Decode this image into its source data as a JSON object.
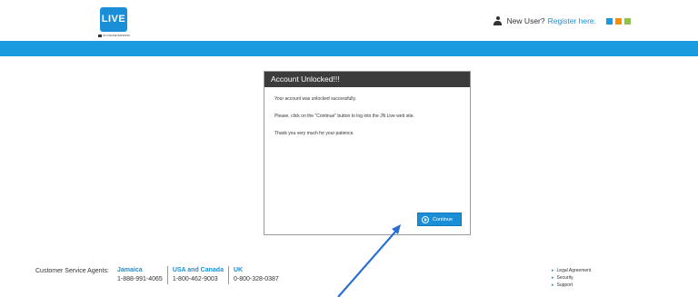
{
  "header": {
    "logo_text": "LIVE",
    "logo_subtext": "JN ONLINE BANKING",
    "new_user_text": "New User?",
    "register_link": "Register here.",
    "color_squares": [
      "#1a9be0",
      "#f39200",
      "#8cc63f"
    ]
  },
  "dialog": {
    "title": "Account Unlocked!!!",
    "messages": [
      "Your account was unlocked successfully.",
      "Please, click on the \"Continue\" button to log into the JN Live web site.",
      "Thank you very much for your patience."
    ],
    "continue_label": "Continue"
  },
  "footer": {
    "agents_label": "Customer Service Agents:",
    "agents": [
      {
        "region": "Jamaica",
        "phone": "1-888-991-4065"
      },
      {
        "region": "USA and Canada",
        "phone": "1-800-462-9003"
      },
      {
        "region": "UK",
        "phone": "0-800-328-0387"
      }
    ],
    "links": [
      "Legal Agreement",
      "Security",
      "Support"
    ]
  },
  "colors": {
    "brand_blue": "#1a9be0",
    "dialog_title_bg": "#3c3c3c",
    "annotation_arrow": "#2a6fd0"
  }
}
